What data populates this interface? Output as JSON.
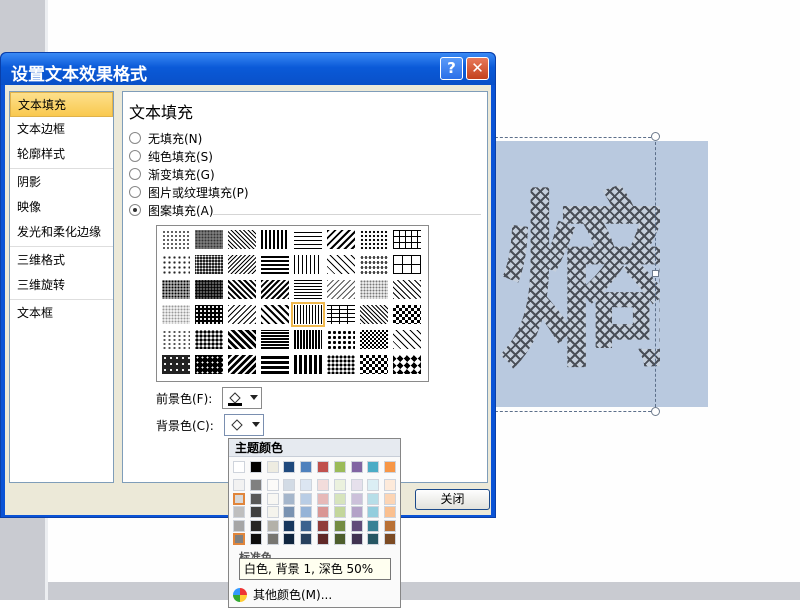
{
  "dialog": {
    "title": "设置文本效果格式",
    "help_label": "?",
    "close_label": "✕",
    "close_button": "关闭"
  },
  "nav": {
    "items": [
      {
        "label": "文本填充"
      },
      {
        "label": "文本边框"
      },
      {
        "label": "轮廓样式"
      },
      {
        "label": "阴影"
      },
      {
        "label": "映像"
      },
      {
        "label": "发光和柔化边缘"
      },
      {
        "label": "三维格式"
      },
      {
        "label": "三维旋转"
      },
      {
        "label": "文本框"
      }
    ]
  },
  "panel": {
    "title": "文本填充",
    "options": [
      {
        "label": "无填充(N)"
      },
      {
        "label": "纯色填充(S)"
      },
      {
        "label": "渐变填充(G)"
      },
      {
        "label": "图片或纹理填充(P)"
      },
      {
        "label": "图案填充(A)"
      }
    ],
    "selected_option": "图案填充(A)",
    "foreground_label": "前景色(F):",
    "background_label": "背景色(C):"
  },
  "slide": {
    "glyph": "熵"
  },
  "color_menu": {
    "theme_header": "主题颜色",
    "standard_header": "标准色",
    "tooltip": "白色, 背景 1, 深色 50%",
    "more_colors": "其他颜色(M)...",
    "theme_colors": [
      "#ffffff",
      "#000000",
      "#eeece1",
      "#1f497d",
      "#4f81bd",
      "#c0504d",
      "#9bbb59",
      "#8064a2",
      "#4bacc6",
      "#f79646"
    ]
  },
  "colors": {
    "titlebar": "#0b5ad8",
    "dialog_face": "#ece9d8",
    "selected_nav": "#f9c94f",
    "textbox_fill": "#b9c9df"
  }
}
